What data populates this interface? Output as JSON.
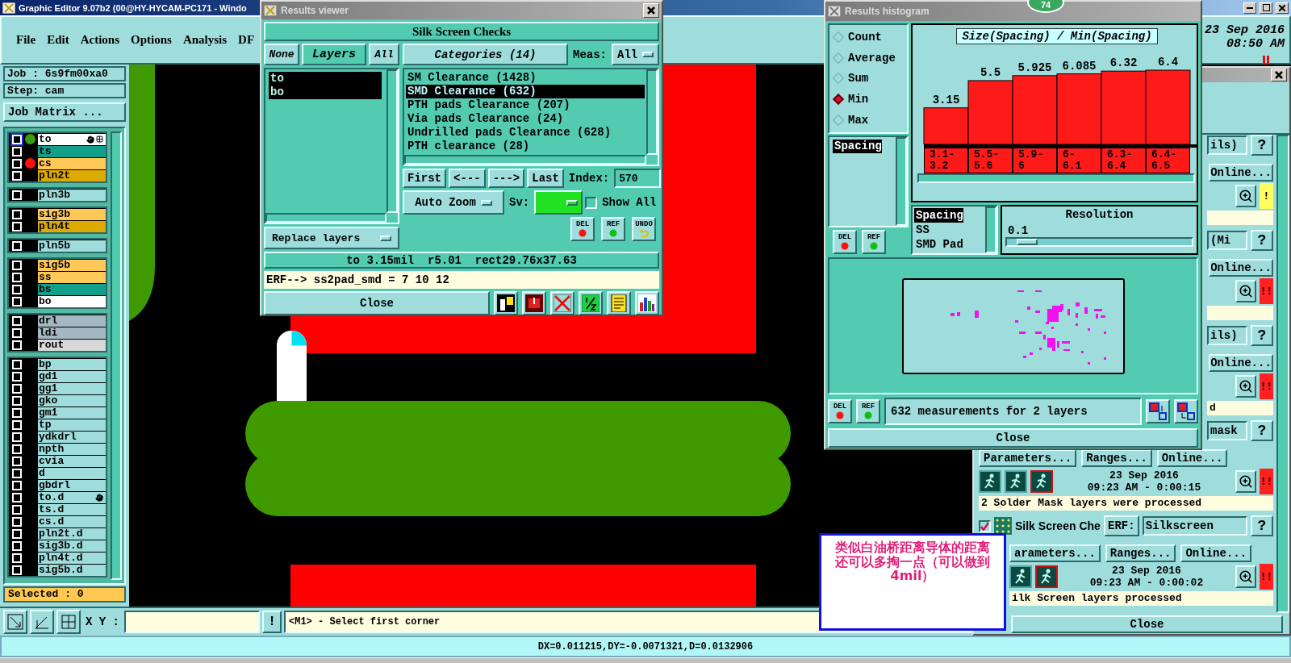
{
  "main_window": {
    "title": "Graphic Editor 9.07b2 (00@HY-HYCAM-PC171 - Windo"
  },
  "menu": [
    "File",
    "Edit",
    "Actions",
    "Options",
    "Analysis",
    "DF"
  ],
  "clock": {
    "date": "23 Sep 2016",
    "time": "08:50 AM"
  },
  "job": {
    "job": "Job : 6s9fm00xa0",
    "step": "Step: cam",
    "matrix_button": "Job Matrix ..."
  },
  "layer_groups": [
    {
      "layers": [
        {
          "name": "to",
          "color": "#ffffff",
          "dot": {
            "color": "#3a9a10"
          },
          "active": true,
          "pointer": true
        },
        {
          "name": "ts",
          "color": "#12a08a",
          "active": false,
          "pointer": false
        },
        {
          "name": "cs",
          "color": "#ffc857",
          "dot": {
            "color": "#ff1010"
          },
          "active": false,
          "pointer": false
        },
        {
          "name": "pln2t",
          "color": "#dcaa00",
          "active": false,
          "pointer": false
        }
      ]
    },
    {
      "layers": [
        {
          "name": "pln3b",
          "color": "#9fdcdc",
          "active": false,
          "pointer": false
        }
      ]
    },
    {
      "layers": [
        {
          "name": "sig3b",
          "color": "#ffc857",
          "active": false,
          "pointer": false
        },
        {
          "name": "pln4t",
          "color": "#dcaa00",
          "active": false,
          "pointer": false
        }
      ]
    },
    {
      "layers": [
        {
          "name": "pln5b",
          "color": "#9fdcdc",
          "active": false,
          "pointer": false
        }
      ]
    },
    {
      "layers": [
        {
          "name": "sig5b",
          "color": "#ffc857",
          "active": false,
          "pointer": false
        },
        {
          "name": "ss",
          "color": "#ffc857",
          "active": false,
          "pointer": false
        },
        {
          "name": "bs",
          "color": "#12a08a",
          "active": false,
          "pointer": false
        },
        {
          "name": "bo",
          "color": "#ffffff",
          "active": false,
          "pointer": false
        }
      ]
    },
    {
      "layers": [
        {
          "name": "drl",
          "color": "#a3b8c0",
          "active": false,
          "pointer": false
        },
        {
          "name": "ldi",
          "color": "#a3b8c0",
          "active": false,
          "pointer": false
        },
        {
          "name": "rout",
          "color": "#d8d8d8",
          "active": false,
          "pointer": false
        }
      ]
    },
    {
      "layers": [
        {
          "name": "bp",
          "color": "#9fdcdc",
          "active": false,
          "pointer": false
        },
        {
          "name": "gd1",
          "color": "#9fdcdc",
          "active": false,
          "pointer": false
        },
        {
          "name": "gg1",
          "color": "#9fdcdc",
          "active": false,
          "pointer": false
        },
        {
          "name": "gko",
          "color": "#9fdcdc",
          "active": false,
          "pointer": false
        },
        {
          "name": "gm1",
          "color": "#9fdcdc",
          "active": false,
          "pointer": false
        },
        {
          "name": "tp",
          "color": "#9fdcdc",
          "active": false,
          "pointer": false
        },
        {
          "name": "ydkdrl",
          "color": "#9fdcdc",
          "active": false,
          "pointer": false
        },
        {
          "name": "npth",
          "color": "#9fdcdc",
          "active": false,
          "pointer": false
        },
        {
          "name": "cvia",
          "color": "#9fdcdc",
          "active": false,
          "pointer": false
        },
        {
          "name": "d",
          "color": "#9fdcdc",
          "active": false,
          "pointer": false
        },
        {
          "name": "gbdrl",
          "color": "#9fdcdc",
          "active": false,
          "pointer": false
        },
        {
          "name": "to.d",
          "color": "#9fdcdc",
          "active": false,
          "pointer": true
        },
        {
          "name": "ts.d",
          "color": "#9fdcdc",
          "active": false,
          "pointer": false
        },
        {
          "name": "cs.d",
          "color": "#9fdcdc",
          "active": false,
          "pointer": false
        },
        {
          "name": "pln2t.d",
          "color": "#9fdcdc",
          "active": false,
          "pointer": false
        },
        {
          "name": "sig3b.d",
          "color": "#9fdcdc",
          "active": false,
          "pointer": false
        },
        {
          "name": "pln4t.d",
          "color": "#9fdcdc",
          "active": false,
          "pointer": false
        },
        {
          "name": "sig5b.d",
          "color": "#9fdcdc",
          "active": false,
          "pointer": false
        }
      ]
    }
  ],
  "selected_count": "Selected : 0",
  "toolbar": {
    "xy_label": "X Y :",
    "alert": "!",
    "message": "<M1> - Select first corner"
  },
  "status_bar": "DX=0.011215,DY=-0.0071321,D=0.0132906",
  "results_viewer": {
    "title": "Results viewer",
    "heading": "Silk Screen Checks",
    "layer_buttons": {
      "none": "None",
      "label": "Layers",
      "all": "All"
    },
    "layers": [
      {
        "name": "to",
        "selected": true
      },
      {
        "name": "bo",
        "selected": true
      }
    ],
    "replace_mode": "Replace layers",
    "categories_button": "Categories (14)",
    "meas_label": "Meas:",
    "meas_value": "All",
    "categories": [
      {
        "label": "SM Clearance (1428)",
        "selected": false
      },
      {
        "label": "SMD Clearance (632)",
        "selected": true
      },
      {
        "label": "PTH pads Clearance (207)",
        "selected": false
      },
      {
        "label": "Via pads Clearance (24)",
        "selected": false
      },
      {
        "label": "Undrilled pads Clearance (628)",
        "selected": false
      },
      {
        "label": "PTH clearance (28)",
        "selected": false
      }
    ],
    "nav": [
      "First",
      "<---",
      "--->",
      "Last"
    ],
    "index_label": "Index:",
    "index_value": "570",
    "zoom_mode": "Auto Zoom",
    "sv_label": "Sv:",
    "show_all": {
      "label": "Show All",
      "checked": false
    },
    "actions": [
      {
        "kind": "del",
        "label": "DEL"
      },
      {
        "kind": "ref",
        "label": "REF"
      },
      {
        "kind": "undo",
        "label": "UNDO"
      }
    ],
    "info": "to 3.15mil  r5.01  rect29.76x37.63",
    "erf": "ERF--> ss2pad_smd = 7 10 12",
    "close": "Close",
    "tools": [
      {
        "kind": "figure"
      },
      {
        "kind": "record"
      },
      {
        "kind": "crossed"
      },
      {
        "kind": "fraction"
      },
      {
        "kind": "notes"
      },
      {
        "kind": "chart"
      }
    ]
  },
  "histogram": {
    "title": "Results histogram",
    "stats": [
      {
        "label": "Count",
        "selected": false
      },
      {
        "label": "Average",
        "selected": false
      },
      {
        "label": "Sum",
        "selected": false
      },
      {
        "label": "Min",
        "selected": true
      },
      {
        "label": "Max",
        "selected": false
      }
    ],
    "fields": [
      {
        "label": "Spacing",
        "selected": true
      }
    ],
    "field_actions": [
      {
        "kind": "del",
        "label": "DEL"
      },
      {
        "kind": "ref",
        "label": "REF"
      }
    ],
    "chart_data": {
      "type": "bar",
      "title": "Size(Spacing) / Min(Spacing)",
      "categories": [
        "3.1-3.2",
        "5.5-5.6",
        "5.9-6",
        "6-6.1",
        "6.3-6.4",
        "6.4-6.5"
      ],
      "values": [
        3.15,
        5.5,
        5.925,
        6.085,
        6.32,
        6.4
      ],
      "data_labels": true
    },
    "attributes": [
      {
        "label": "Spacing",
        "selected": true
      },
      {
        "label": "SS",
        "selected": false
      },
      {
        "label": "SMD Pad",
        "selected": false
      }
    ],
    "resolution": {
      "label": "Resolution",
      "value": "0.1",
      "level": 0.06
    },
    "map_actions": [
      {
        "kind": "del",
        "label": "DEL"
      },
      {
        "kind": "ref",
        "label": "REF"
      }
    ],
    "summary": "632 measurements for 2 layers",
    "close": "Close"
  },
  "checks_panel": {
    "blocks": [
      {
        "kind": "clipped",
        "field": "ils)",
        "help": "?",
        "buttons": [
          "Online..."
        ],
        "flag": {
          "kind": "warning",
          "label": "!"
        }
      },
      {
        "kind": "clipped",
        "field": "(Mi",
        "help": "?",
        "buttons": [
          "Online..."
        ],
        "flag": {
          "kind": "error",
          "label": "!!"
        }
      },
      {
        "kind": "clipped",
        "field": "ils)",
        "help": "?",
        "buttons": [
          "Online..."
        ],
        "flag": {
          "kind": "error",
          "label": "!!"
        },
        "message": "d"
      },
      {
        "kind": "full",
        "field": "mask",
        "help": "?",
        "buttons": [
          "Parameters...",
          "Ranges...",
          "Online..."
        ],
        "date": "23 Sep 2016",
        "time": "09:23 AM - 0:00:15",
        "flag": {
          "kind": "error",
          "label": "!!"
        },
        "message": "2 Solder Mask layers were processed"
      },
      {
        "kind": "inset",
        "checked": true,
        "name": "Silk Screen Che",
        "erf_label": "ERF:",
        "field": "Silkscreen",
        "help": "?",
        "buttons": [
          "arameters...",
          "Ranges...",
          "Online..."
        ],
        "date": "23 Sep 2016",
        "time": "09:23 AM - 0:00:02",
        "flag": {
          "kind": "error",
          "label": "!!"
        },
        "message": "ilk Screen layers processed"
      }
    ],
    "close": "Close"
  },
  "note": "类似白油桥距离导体的距离还可以多掏一点（可以做到4mil）",
  "badge": "74"
}
